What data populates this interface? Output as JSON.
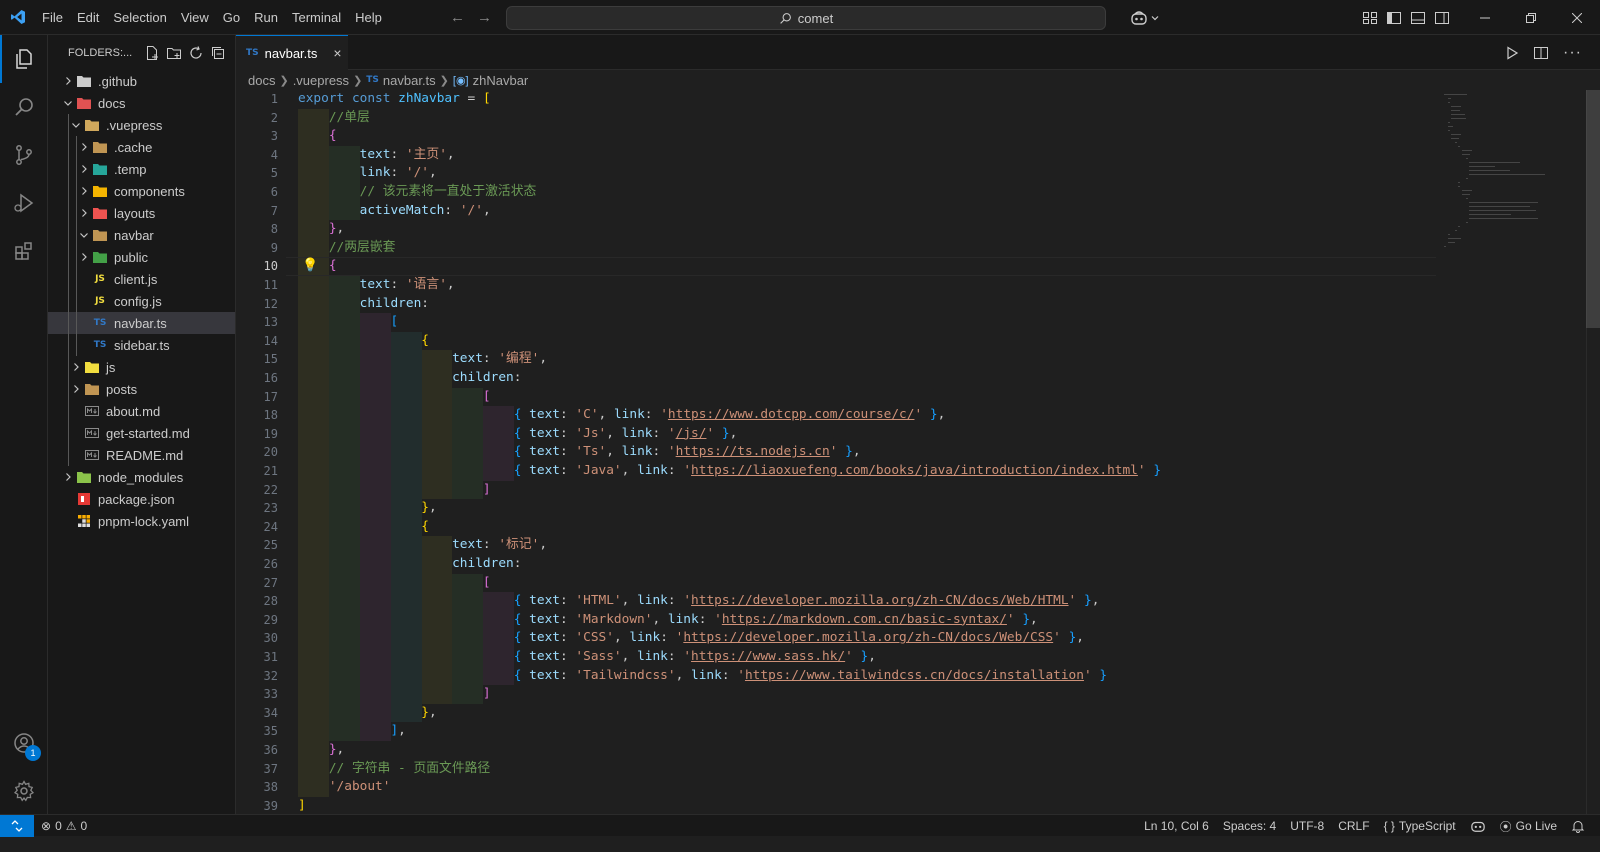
{
  "menu": [
    "File",
    "Edit",
    "Selection",
    "View",
    "Go",
    "Run",
    "Terminal",
    "Help"
  ],
  "search": {
    "text": "comet"
  },
  "sidebar": {
    "title": "FOLDERS:...",
    "items": [
      {
        "label": ".github",
        "depth": 0,
        "chev": "right",
        "icon": "github-folder-icon",
        "color": "#cccccc"
      },
      {
        "label": "docs",
        "depth": 0,
        "chev": "down",
        "icon": "docs-folder-icon",
        "color": "#e05252"
      },
      {
        "label": ".vuepress",
        "depth": 1,
        "chev": "down",
        "icon": "vuepress-folder-icon",
        "color": "#d0a85c"
      },
      {
        "label": ".cache",
        "depth": 2,
        "chev": "right",
        "icon": "folder-icon",
        "color": "#c09553"
      },
      {
        "label": ".temp",
        "depth": 2,
        "chev": "right",
        "icon": "temp-folder-icon",
        "color": "#26a69a"
      },
      {
        "label": "components",
        "depth": 2,
        "chev": "right",
        "icon": "components-folder-icon",
        "color": "#f4b400"
      },
      {
        "label": "layouts",
        "depth": 2,
        "chev": "right",
        "icon": "layouts-folder-icon",
        "color": "#ef5350"
      },
      {
        "label": "navbar",
        "depth": 2,
        "chev": "down",
        "icon": "folder-open-icon",
        "color": "#c09553"
      },
      {
        "label": "public",
        "depth": 2,
        "chev": "right",
        "icon": "public-folder-icon",
        "color": "#43a047"
      },
      {
        "label": "client.js",
        "depth": 2,
        "chev": "",
        "icon": "js-file-icon",
        "color": "#f1dd3f"
      },
      {
        "label": "config.js",
        "depth": 2,
        "chev": "",
        "icon": "js-file-icon",
        "color": "#f1dd3f"
      },
      {
        "label": "navbar.ts",
        "depth": 2,
        "chev": "",
        "icon": "ts-file-icon",
        "color": "#3178c6",
        "selected": true
      },
      {
        "label": "sidebar.ts",
        "depth": 2,
        "chev": "",
        "icon": "ts-file-icon",
        "color": "#3178c6"
      },
      {
        "label": "js",
        "depth": 1,
        "chev": "right",
        "icon": "js-folder-icon",
        "color": "#f1dd3f"
      },
      {
        "label": "posts",
        "depth": 1,
        "chev": "right",
        "icon": "folder-icon",
        "color": "#c09553"
      },
      {
        "label": "about.md",
        "depth": 1,
        "chev": "",
        "icon": "markdown-file-icon",
        "color": "#8a8a8a"
      },
      {
        "label": "get-started.md",
        "depth": 1,
        "chev": "",
        "icon": "markdown-file-icon",
        "color": "#8a8a8a"
      },
      {
        "label": "README.md",
        "depth": 1,
        "chev": "",
        "icon": "markdown-file-icon",
        "color": "#8a8a8a"
      },
      {
        "label": "node_modules",
        "depth": 0,
        "chev": "right",
        "icon": "node-folder-icon",
        "color": "#8bc34a"
      },
      {
        "label": "package.json",
        "depth": 0,
        "chev": "",
        "icon": "npm-file-icon",
        "color": "#e53935"
      },
      {
        "label": "pnpm-lock.yaml",
        "depth": 0,
        "chev": "",
        "icon": "pnpm-file-icon",
        "color": "#f9ad00"
      }
    ]
  },
  "tab": {
    "label": "navbar.ts",
    "icon_text": "TS"
  },
  "breadcrumb": {
    "parts": [
      "docs",
      ".vuepress",
      "navbar.ts",
      "zhNavbar"
    ],
    "ts_label": "TS"
  },
  "editor": {
    "current_line": 10,
    "lines": [
      [
        [
          "export ",
          "kw"
        ],
        [
          "const ",
          "kw"
        ],
        [
          "zhNavbar",
          "var"
        ],
        [
          " = ",
          ""
        ],
        [
          "[",
          "b1"
        ]
      ],
      [
        [
          "    ",
          ""
        ],
        [
          "//单层",
          "cm"
        ]
      ],
      [
        [
          "    ",
          ""
        ],
        [
          "{",
          "b2"
        ]
      ],
      [
        [
          "        ",
          ""
        ],
        [
          "text",
          "prop"
        ],
        [
          ": ",
          ""
        ],
        [
          "'主页'",
          "str"
        ],
        [
          ",",
          ""
        ]
      ],
      [
        [
          "        ",
          ""
        ],
        [
          "link",
          "prop"
        ],
        [
          ": ",
          ""
        ],
        [
          "'/'",
          "str"
        ],
        [
          ",",
          ""
        ]
      ],
      [
        [
          "        ",
          ""
        ],
        [
          "// 该元素将一直处于激活状态",
          "cm"
        ]
      ],
      [
        [
          "        ",
          ""
        ],
        [
          "activeMatch",
          "prop"
        ],
        [
          ": ",
          ""
        ],
        [
          "'/'",
          "str"
        ],
        [
          ",",
          ""
        ]
      ],
      [
        [
          "    ",
          ""
        ],
        [
          "}",
          "b2"
        ],
        [
          ",",
          ""
        ]
      ],
      [
        [
          "    ",
          ""
        ],
        [
          "//两层嵌套",
          "cm"
        ]
      ],
      [
        [
          "    ",
          ""
        ],
        [
          "{",
          "b2"
        ]
      ],
      [
        [
          "        ",
          ""
        ],
        [
          "text",
          "prop"
        ],
        [
          ": ",
          ""
        ],
        [
          "'语言'",
          "str"
        ],
        [
          ",",
          ""
        ]
      ],
      [
        [
          "        ",
          ""
        ],
        [
          "children",
          "prop"
        ],
        [
          ":",
          ""
        ]
      ],
      [
        [
          "            ",
          ""
        ],
        [
          "[",
          "b3"
        ]
      ],
      [
        [
          "                ",
          ""
        ],
        [
          "{",
          "b1"
        ]
      ],
      [
        [
          "                    ",
          ""
        ],
        [
          "text",
          "prop"
        ],
        [
          ": ",
          ""
        ],
        [
          "'编程'",
          "str"
        ],
        [
          ",",
          ""
        ]
      ],
      [
        [
          "                    ",
          ""
        ],
        [
          "children",
          "prop"
        ],
        [
          ":",
          ""
        ]
      ],
      [
        [
          "                        ",
          ""
        ],
        [
          "[",
          "b2"
        ]
      ],
      [
        [
          "                            ",
          ""
        ],
        [
          "{ ",
          "b3"
        ],
        [
          "text",
          "prop"
        ],
        [
          ": ",
          ""
        ],
        [
          "'C'",
          "str"
        ],
        [
          ", ",
          ""
        ],
        [
          "link",
          "prop"
        ],
        [
          ": ",
          ""
        ],
        [
          "'",
          "str"
        ],
        [
          "https://www.dotcpp.com/course/c/",
          "str url"
        ],
        [
          "'",
          "str"
        ],
        [
          " }",
          "b3"
        ],
        [
          ",",
          ""
        ]
      ],
      [
        [
          "                            ",
          ""
        ],
        [
          "{ ",
          "b3"
        ],
        [
          "text",
          "prop"
        ],
        [
          ": ",
          ""
        ],
        [
          "'Js'",
          "str"
        ],
        [
          ", ",
          ""
        ],
        [
          "link",
          "prop"
        ],
        [
          ": ",
          ""
        ],
        [
          "'",
          "str"
        ],
        [
          "/js/",
          "str url"
        ],
        [
          "'",
          "str"
        ],
        [
          " }",
          "b3"
        ],
        [
          ",",
          ""
        ]
      ],
      [
        [
          "                            ",
          ""
        ],
        [
          "{ ",
          "b3"
        ],
        [
          "text",
          "prop"
        ],
        [
          ": ",
          ""
        ],
        [
          "'Ts'",
          "str"
        ],
        [
          ", ",
          ""
        ],
        [
          "link",
          "prop"
        ],
        [
          ": ",
          ""
        ],
        [
          "'",
          "str"
        ],
        [
          "https://ts.nodejs.cn",
          "str url"
        ],
        [
          "'",
          "str"
        ],
        [
          " }",
          "b3"
        ],
        [
          ",",
          ""
        ]
      ],
      [
        [
          "                            ",
          ""
        ],
        [
          "{ ",
          "b3"
        ],
        [
          "text",
          "prop"
        ],
        [
          ": ",
          ""
        ],
        [
          "'Java'",
          "str"
        ],
        [
          ", ",
          ""
        ],
        [
          "link",
          "prop"
        ],
        [
          ": ",
          ""
        ],
        [
          "'",
          "str"
        ],
        [
          "https://liaoxuefeng.com/books/java/introduction/index.html",
          "str url"
        ],
        [
          "'",
          "str"
        ],
        [
          " }",
          "b3"
        ]
      ],
      [
        [
          "                        ",
          ""
        ],
        [
          "]",
          "b2"
        ]
      ],
      [
        [
          "                ",
          ""
        ],
        [
          "}",
          "b1"
        ],
        [
          ",",
          ""
        ]
      ],
      [
        [
          "                ",
          ""
        ],
        [
          "{",
          "b1"
        ]
      ],
      [
        [
          "                    ",
          ""
        ],
        [
          "text",
          "prop"
        ],
        [
          ": ",
          ""
        ],
        [
          "'标记'",
          "str"
        ],
        [
          ",",
          ""
        ]
      ],
      [
        [
          "                    ",
          ""
        ],
        [
          "children",
          "prop"
        ],
        [
          ":",
          ""
        ]
      ],
      [
        [
          "                        ",
          ""
        ],
        [
          "[",
          "b2"
        ]
      ],
      [
        [
          "                            ",
          ""
        ],
        [
          "{ ",
          "b3"
        ],
        [
          "text",
          "prop"
        ],
        [
          ": ",
          ""
        ],
        [
          "'HTML'",
          "str"
        ],
        [
          ", ",
          ""
        ],
        [
          "link",
          "prop"
        ],
        [
          ": ",
          ""
        ],
        [
          "'",
          "str"
        ],
        [
          "https://developer.mozilla.org/zh-CN/docs/Web/HTML",
          "str url"
        ],
        [
          "'",
          "str"
        ],
        [
          " }",
          "b3"
        ],
        [
          ",",
          ""
        ]
      ],
      [
        [
          "                            ",
          ""
        ],
        [
          "{ ",
          "b3"
        ],
        [
          "text",
          "prop"
        ],
        [
          ": ",
          ""
        ],
        [
          "'Markdown'",
          "str"
        ],
        [
          ", ",
          ""
        ],
        [
          "link",
          "prop"
        ],
        [
          ": ",
          ""
        ],
        [
          "'",
          "str"
        ],
        [
          "https://markdown.com.cn/basic-syntax/",
          "str url"
        ],
        [
          "'",
          "str"
        ],
        [
          " }",
          "b3"
        ],
        [
          ",",
          ""
        ]
      ],
      [
        [
          "                            ",
          ""
        ],
        [
          "{ ",
          "b3"
        ],
        [
          "text",
          "prop"
        ],
        [
          ": ",
          ""
        ],
        [
          "'CSS'",
          "str"
        ],
        [
          ", ",
          ""
        ],
        [
          "link",
          "prop"
        ],
        [
          ": ",
          ""
        ],
        [
          "'",
          "str"
        ],
        [
          "https://developer.mozilla.org/zh-CN/docs/Web/CSS",
          "str url"
        ],
        [
          "'",
          "str"
        ],
        [
          " }",
          "b3"
        ],
        [
          ",",
          ""
        ]
      ],
      [
        [
          "                            ",
          ""
        ],
        [
          "{ ",
          "b3"
        ],
        [
          "text",
          "prop"
        ],
        [
          ": ",
          ""
        ],
        [
          "'Sass'",
          "str"
        ],
        [
          ", ",
          ""
        ],
        [
          "link",
          "prop"
        ],
        [
          ": ",
          ""
        ],
        [
          "'",
          "str"
        ],
        [
          "https://www.sass.hk/",
          "str url"
        ],
        [
          "'",
          "str"
        ],
        [
          " }",
          "b3"
        ],
        [
          ",",
          ""
        ]
      ],
      [
        [
          "                            ",
          ""
        ],
        [
          "{ ",
          "b3"
        ],
        [
          "text",
          "prop"
        ],
        [
          ": ",
          ""
        ],
        [
          "'Tailwindcss'",
          "str"
        ],
        [
          ", ",
          ""
        ],
        [
          "link",
          "prop"
        ],
        [
          ": ",
          ""
        ],
        [
          "'",
          "str"
        ],
        [
          "https://www.tailwindcss.cn/docs/installation",
          "str url"
        ],
        [
          "'",
          "str"
        ],
        [
          " }",
          "b3"
        ]
      ],
      [
        [
          "                        ",
          ""
        ],
        [
          "]",
          "b2"
        ]
      ],
      [
        [
          "                ",
          ""
        ],
        [
          "}",
          "b1"
        ],
        [
          ",",
          ""
        ]
      ],
      [
        [
          "            ",
          ""
        ],
        [
          "]",
          "b3"
        ],
        [
          ",",
          ""
        ]
      ],
      [
        [
          "    ",
          ""
        ],
        [
          "}",
          "b2"
        ],
        [
          ",",
          ""
        ]
      ],
      [
        [
          "    ",
          ""
        ],
        [
          "// 字符串 - 页面文件路径",
          "cm"
        ]
      ],
      [
        [
          "    ",
          ""
        ],
        [
          "'/about'",
          "str"
        ]
      ],
      [
        [
          "]",
          "b1"
        ]
      ]
    ]
  },
  "status": {
    "errors": "0",
    "warnings": "0",
    "position": "Ln 10, Col 6",
    "spaces": "Spaces: 4",
    "encoding": "UTF-8",
    "eol": "CRLF",
    "lang_braces": "{ }",
    "language": "TypeScript",
    "golive": "Go Live"
  },
  "accounts_badge": "1"
}
